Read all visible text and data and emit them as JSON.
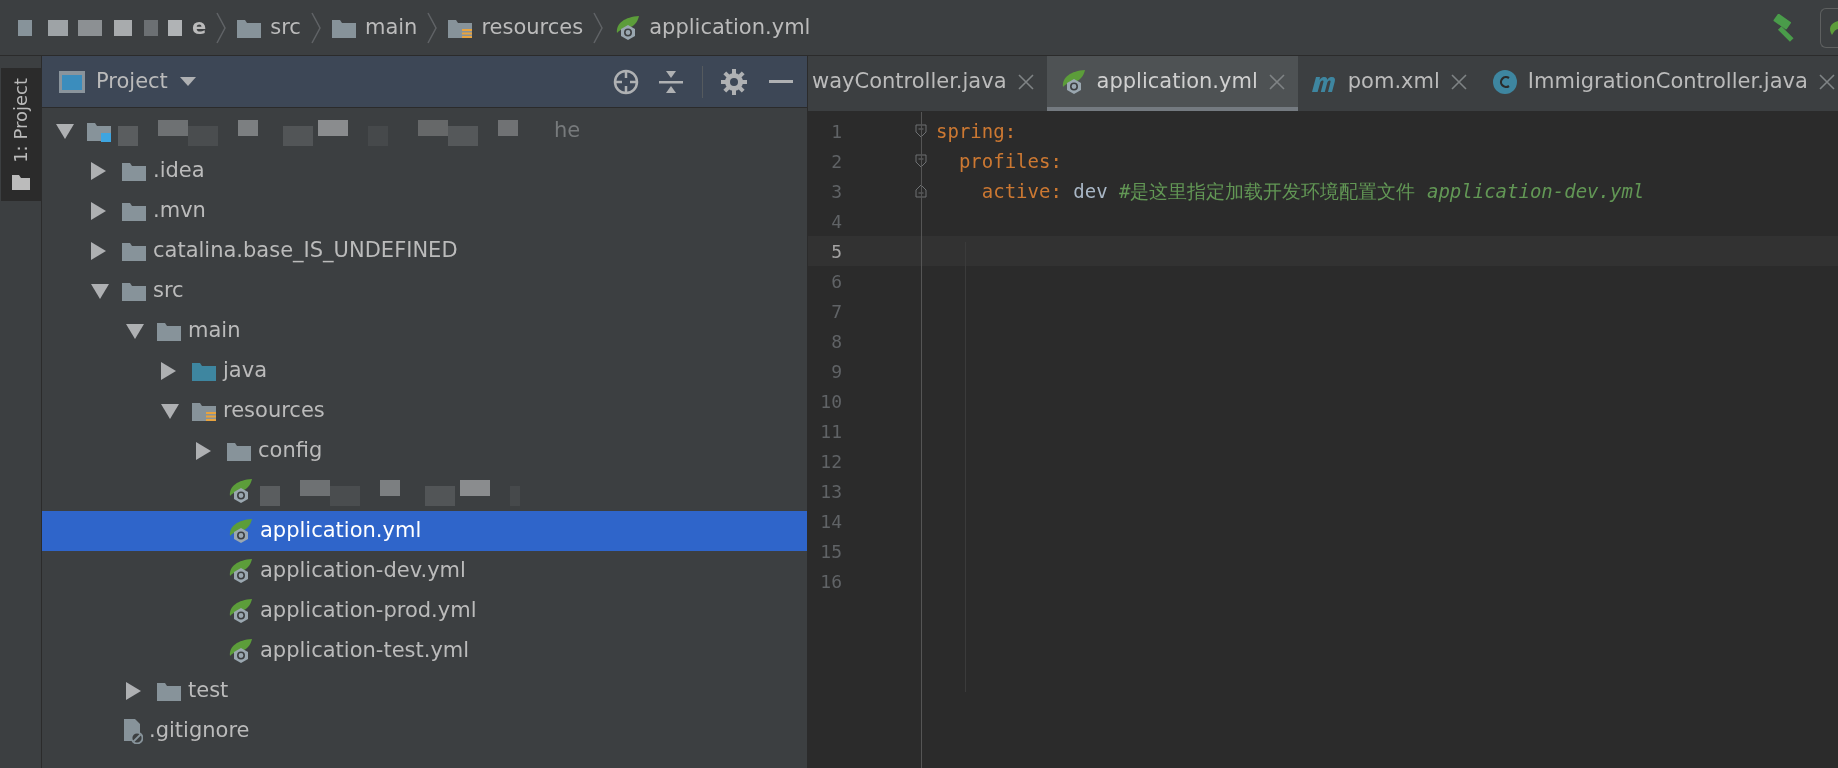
{
  "breadcrumbs": [
    {
      "label": "e",
      "kind": "redacted"
    },
    {
      "label": "src",
      "kind": "folder"
    },
    {
      "label": "main",
      "kind": "folder"
    },
    {
      "label": "resources",
      "kind": "resources"
    },
    {
      "label": "application.yml",
      "kind": "spring"
    }
  ],
  "side_stripe": {
    "label": "1: Project",
    "selected": true
  },
  "project_panel": {
    "title": "Project",
    "tree": [
      {
        "label": "he",
        "kind": "module",
        "redacted": true,
        "expanded": true,
        "selected": false,
        "children": [
          {
            "label": ".idea",
            "kind": "folder",
            "expanded": false,
            "selected": false
          },
          {
            "label": ".mvn",
            "kind": "folder",
            "expanded": false,
            "selected": false
          },
          {
            "label": "catalina.base_IS_UNDEFINED",
            "kind": "folder",
            "expanded": false,
            "selected": false
          },
          {
            "label": "src",
            "kind": "folder",
            "expanded": true,
            "selected": false,
            "children": [
              {
                "label": "main",
                "kind": "folder",
                "expanded": true,
                "selected": false,
                "children": [
                  {
                    "label": "java",
                    "kind": "source",
                    "expanded": false,
                    "selected": false
                  },
                  {
                    "label": "resources",
                    "kind": "resources",
                    "expanded": true,
                    "selected": false,
                    "children": [
                      {
                        "label": "config",
                        "kind": "folder",
                        "expanded": false,
                        "selected": false
                      },
                      {
                        "kind": "spring",
                        "redacted": true,
                        "selected": false
                      },
                      {
                        "label": "application.yml",
                        "kind": "spring",
                        "selected": true
                      },
                      {
                        "label": "application-dev.yml",
                        "kind": "spring",
                        "selected": false
                      },
                      {
                        "label": "application-prod.yml",
                        "kind": "spring",
                        "selected": false
                      },
                      {
                        "label": "application-test.yml",
                        "kind": "spring",
                        "selected": false
                      }
                    ]
                  }
                ]
              },
              {
                "label": "test",
                "kind": "folder",
                "expanded": false,
                "selected": false
              }
            ]
          },
          {
            "label": ".gitignore",
            "kind": "ignore",
            "selected": false
          }
        ]
      }
    ]
  },
  "tabs": [
    {
      "label": "wayController.java",
      "kind": "plain",
      "selected": false
    },
    {
      "label": "application.yml",
      "kind": "spring",
      "selected": true
    },
    {
      "label": "pom.xml",
      "kind": "maven",
      "selected": false
    },
    {
      "label": "ImmigrationController.java",
      "kind": "class",
      "selected": false
    }
  ],
  "editor": {
    "lines": [
      {
        "number": "1",
        "fold_start": true,
        "fold_end": false,
        "selected": false,
        "tokens": [
          {
            "text": "spring",
            "kind": "key"
          },
          {
            "text": ":",
            "kind": "punct"
          }
        ]
      },
      {
        "number": "2",
        "fold_start": true,
        "fold_end": false,
        "selected": false,
        "tokens": [
          {
            "text": "  profiles",
            "kind": "key"
          },
          {
            "text": ":",
            "kind": "punct"
          }
        ]
      },
      {
        "number": "3",
        "fold_start": false,
        "fold_end": true,
        "selected": false,
        "tokens": [
          {
            "text": "    active",
            "kind": "key"
          },
          {
            "text": ":",
            "kind": "punct"
          },
          {
            "text": " dev ",
            "kind": "plain"
          },
          {
            "text": "#是这里指定加载开发环境配置文件 *application-dev.yml*",
            "kind": "comment"
          }
        ]
      },
      {
        "number": "4",
        "selected": false
      },
      {
        "number": "5",
        "selected": true
      },
      {
        "number": "6",
        "selected": false
      },
      {
        "number": "7",
        "selected": false
      },
      {
        "number": "8",
        "selected": false
      },
      {
        "number": "9",
        "selected": false
      },
      {
        "number": "10",
        "selected": false
      },
      {
        "number": "11",
        "selected": false
      },
      {
        "number": "12",
        "selected": false
      },
      {
        "number": "13",
        "selected": false
      },
      {
        "number": "14",
        "selected": false
      },
      {
        "number": "15",
        "selected": false
      },
      {
        "number": "16",
        "selected": false
      }
    ]
  }
}
